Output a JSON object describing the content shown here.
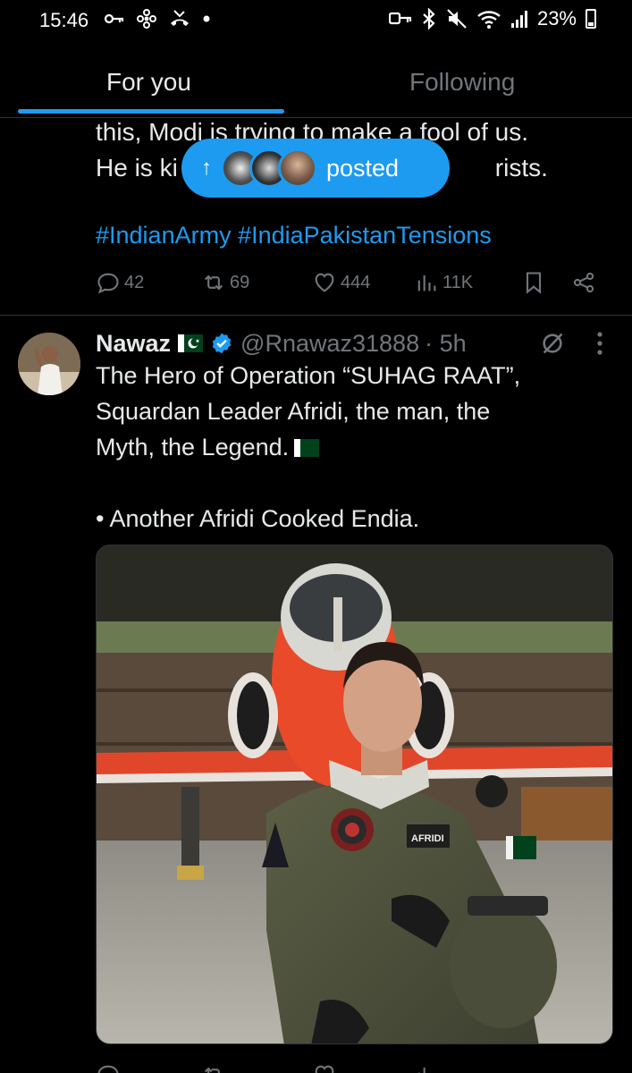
{
  "status_bar": {
    "time": "15:46",
    "battery": "23%"
  },
  "tabs": [
    {
      "label": "For you"
    },
    {
      "label": "Following"
    }
  ],
  "previous_tweet": {
    "text_line1": "this, Modi is trying to make a fool of us.",
    "text_line2": "He is ki",
    "text_line2_end": "rists.",
    "hashtags": "#IndianArmy #IndiaPakistanTensions",
    "replies": "42",
    "reposts": "69",
    "likes": "444",
    "views": "11K"
  },
  "new_posts_pill": {
    "label": "posted"
  },
  "tweet": {
    "name": "Nawaz",
    "handle": "@Rnawaz31888",
    "time": "· 5h",
    "lines": [
      "The Hero of Operation “SUHAG RAAT”,",
      "Squardan Leader Afridi, the man, the",
      "Myth, the Legend."
    ],
    "bullet": "• Another Afridi Cooked Endia.",
    "media_name_patch": "AFRIDI"
  },
  "colors": {
    "accent": "#1d9bf0",
    "background": "#000000",
    "muted": "#71767b",
    "text": "#e7e9ea",
    "divider": "#2f3336"
  },
  "icons": [
    "key-icon",
    "fan-icon",
    "missed-call-icon",
    "dot-icon",
    "bluetooth-icon",
    "mute-icon",
    "wifi-icon",
    "signal-icon",
    "battery-icon",
    "reply-icon",
    "repost-icon",
    "like-icon",
    "views-icon",
    "bookmark-icon",
    "share-icon",
    "grok-icon",
    "more-icon",
    "verified-icon",
    "up-arrow-icon"
  ]
}
